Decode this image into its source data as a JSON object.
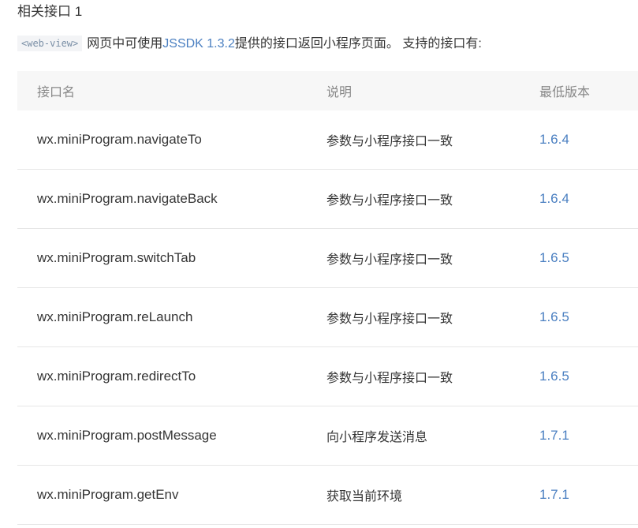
{
  "heading": "相关接口 1",
  "intro": {
    "code_tag": "<web-view>",
    "text_before_link": "网页中可使用",
    "link_text": "JSSDK 1.3.2",
    "text_after_link": "提供的接口返回小程序页面。 支持的接口有:"
  },
  "table": {
    "headers": {
      "name": "接口名",
      "desc": "说明",
      "version": "最低版本"
    },
    "rows": [
      {
        "name": "wx.miniProgram.navigateTo",
        "desc": "参数与小程序接口一致",
        "version": "1.6.4"
      },
      {
        "name": "wx.miniProgram.navigateBack",
        "desc": "参数与小程序接口一致",
        "version": "1.6.4"
      },
      {
        "name": "wx.miniProgram.switchTab",
        "desc": "参数与小程序接口一致",
        "version": "1.6.5"
      },
      {
        "name": "wx.miniProgram.reLaunch",
        "desc": "参数与小程序接口一致",
        "version": "1.6.5"
      },
      {
        "name": "wx.miniProgram.redirectTo",
        "desc": "参数与小程序接口一致",
        "version": "1.6.5"
      },
      {
        "name": "wx.miniProgram.postMessage",
        "desc": "向小程序发送消息",
        "version": "1.7.1"
      },
      {
        "name": "wx.miniProgram.getEnv",
        "desc": "获取当前环境",
        "version": "1.7.1"
      }
    ]
  },
  "colors": {
    "link": "#4a7fc1",
    "header_bg": "#f7f7f7",
    "text": "#353535",
    "muted": "#888888"
  }
}
